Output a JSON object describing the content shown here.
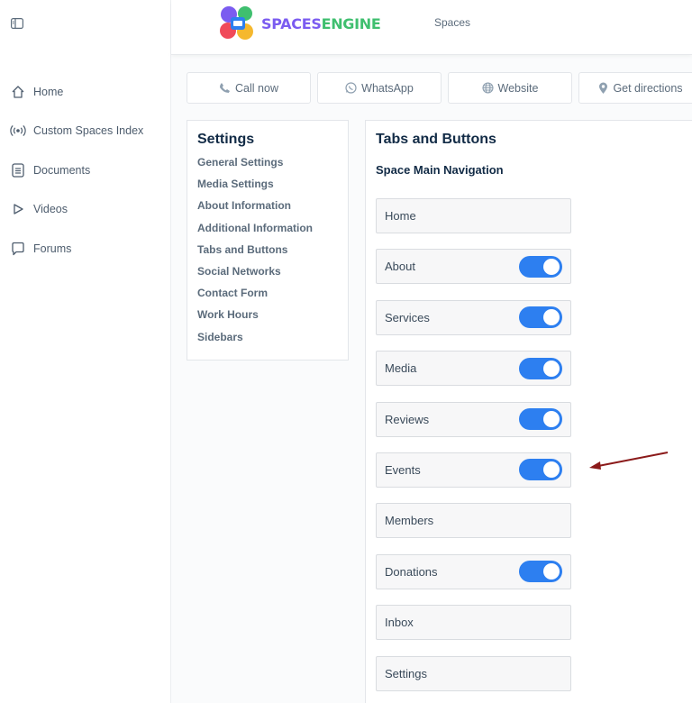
{
  "sidebar": {
    "items": [
      {
        "label": "Home",
        "icon": "home-icon"
      },
      {
        "label": "Custom Spaces Index",
        "icon": "broadcast-icon"
      },
      {
        "label": "Documents",
        "icon": "document-icon"
      },
      {
        "label": "Videos",
        "icon": "play-icon"
      },
      {
        "label": "Forums",
        "icon": "chat-icon"
      }
    ]
  },
  "header": {
    "logo_part1": "SPACES",
    "logo_part2": "ENGINE",
    "link": "Spaces"
  },
  "actions": {
    "call": "Call now",
    "whatsapp": "WhatsApp",
    "website": "Website",
    "directions": "Get directions"
  },
  "settings": {
    "title": "Settings",
    "links": [
      "General Settings",
      "Media Settings",
      "About Information",
      "Additional Information",
      "Tabs and Buttons",
      "Social Networks",
      "Contact Form",
      "Work Hours",
      "Sidebars"
    ]
  },
  "tabs_panel": {
    "title": "Tabs and Buttons",
    "subtitle": "Space Main Navigation",
    "rows": [
      {
        "label": "Home",
        "toggle": false
      },
      {
        "label": "About",
        "toggle": true
      },
      {
        "label": "Services",
        "toggle": true
      },
      {
        "label": "Media",
        "toggle": true
      },
      {
        "label": "Reviews",
        "toggle": true
      },
      {
        "label": "Events",
        "toggle": true
      },
      {
        "label": "Members",
        "toggle": false
      },
      {
        "label": "Donations",
        "toggle": true
      },
      {
        "label": "Inbox",
        "toggle": false
      },
      {
        "label": "Settings",
        "toggle": false
      }
    ]
  },
  "colors": {
    "toggle_on": "#2d7ff0",
    "arrow": "#8b1a1a",
    "logo_purple": "#7b5cf0",
    "logo_green": "#3fbf6f"
  }
}
